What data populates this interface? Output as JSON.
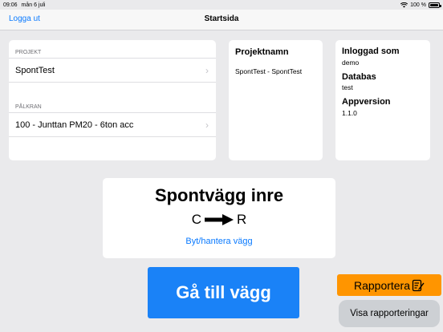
{
  "status_bar": {
    "time": "09:06",
    "date": "mån 6 juli",
    "battery": "100 %"
  },
  "nav": {
    "back_label": "Logga ut",
    "title": "Startsida"
  },
  "project_section": {
    "header": "PROJEKT",
    "value": "SpontTest"
  },
  "rig_section": {
    "header": "PÅLKRAN",
    "value": "100 - Junttan PM20 - 6ton acc"
  },
  "project_name_card": {
    "title": "Projektnamn",
    "value": "SpontTest - SpontTest"
  },
  "session_card": {
    "logged_in_title": "Inloggad som",
    "logged_in_value": "demo",
    "database_title": "Databas",
    "database_value": "test",
    "app_version_title": "Appversion",
    "app_version_value": "1.1.0"
  },
  "wall": {
    "title": "Spontvägg inre",
    "from": "C",
    "to": "R",
    "change_link": "Byt/hantera vägg"
  },
  "actions": {
    "goto_wall": "Gå till vägg",
    "report": "Rapportera",
    "show_reports": "Visa rapporteringar"
  },
  "colors": {
    "accent": "#0a7aff",
    "primary_button": "#1a82f7",
    "report_button": "#ff9500"
  },
  "icons": [
    "wifi-icon",
    "battery-icon",
    "chevron-right-icon",
    "arrow-right-icon",
    "edit-note-icon"
  ]
}
